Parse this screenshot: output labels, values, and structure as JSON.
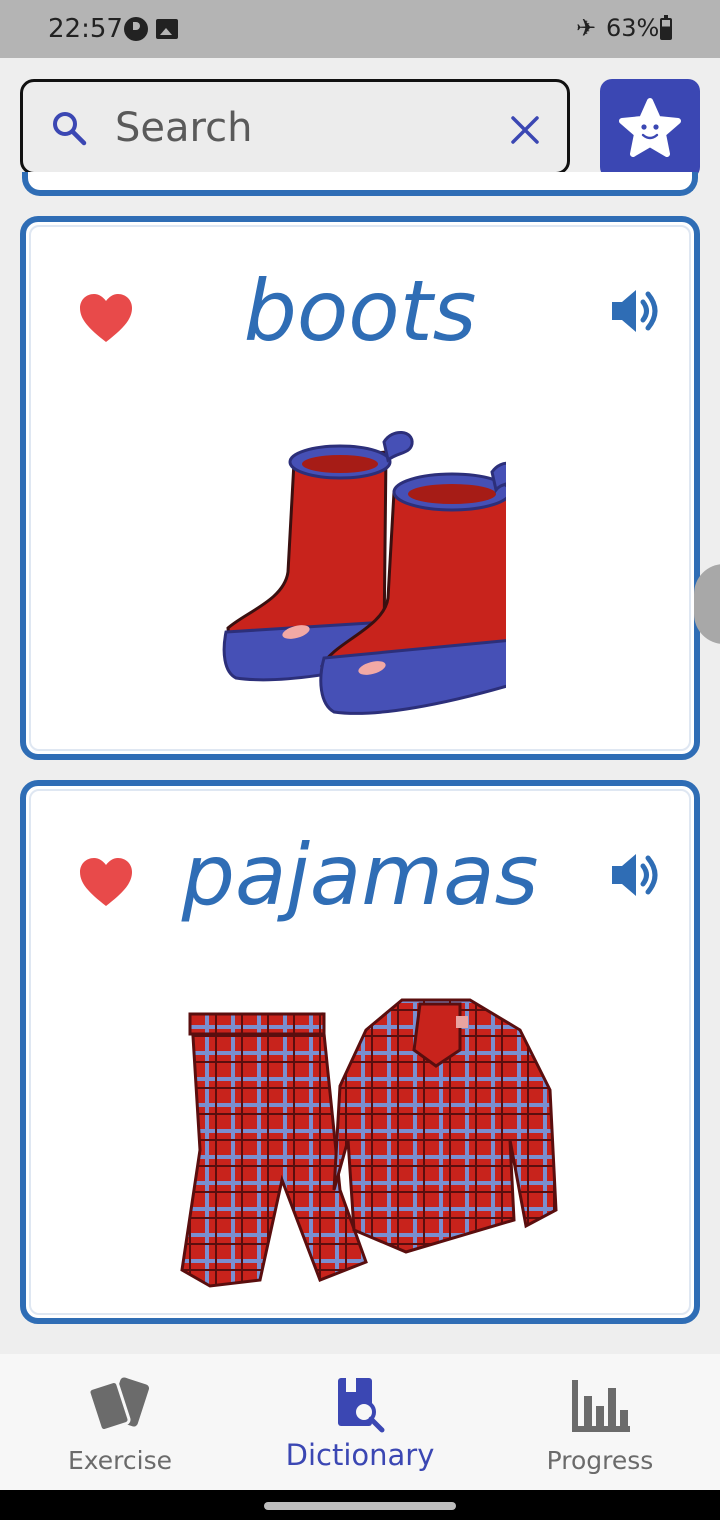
{
  "status_bar": {
    "time": "22:57",
    "battery": "63%",
    "icons": [
      "data-saver-icon",
      "image-icon",
      "airplane-mode-icon",
      "battery-icon"
    ]
  },
  "search": {
    "placeholder": "Search",
    "value": ""
  },
  "colors": {
    "accent": "#2f6db5",
    "nav_active": "#3b47b3",
    "heart": "#e84a4a"
  },
  "cards": [
    {
      "word": "boots",
      "favorited": true,
      "image": "red rubber boots illustration"
    },
    {
      "word": "pajamas",
      "favorited": true,
      "image": "red plaid pajamas illustration"
    }
  ],
  "bottom_nav": {
    "items": [
      {
        "label": "Exercise",
        "icon": "cards-icon",
        "active": false
      },
      {
        "label": "Dictionary",
        "icon": "dictionary-search-icon",
        "active": true
      },
      {
        "label": "Progress",
        "icon": "bar-chart-icon",
        "active": false
      }
    ]
  }
}
